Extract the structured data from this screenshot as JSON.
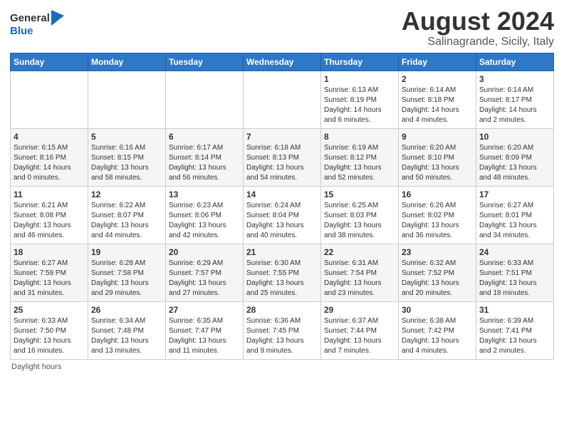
{
  "header": {
    "logo_general": "General",
    "logo_blue": "Blue",
    "month_year": "August 2024",
    "location": "Salinagrande, Sicily, Italy"
  },
  "weekdays": [
    "Sunday",
    "Monday",
    "Tuesday",
    "Wednesday",
    "Thursday",
    "Friday",
    "Saturday"
  ],
  "weeks": [
    [
      {
        "day": "",
        "info": ""
      },
      {
        "day": "",
        "info": ""
      },
      {
        "day": "",
        "info": ""
      },
      {
        "day": "",
        "info": ""
      },
      {
        "day": "1",
        "info": "Sunrise: 6:13 AM\nSunset: 8:19 PM\nDaylight: 14 hours\nand 6 minutes."
      },
      {
        "day": "2",
        "info": "Sunrise: 6:14 AM\nSunset: 8:18 PM\nDaylight: 14 hours\nand 4 minutes."
      },
      {
        "day": "3",
        "info": "Sunrise: 6:14 AM\nSunset: 8:17 PM\nDaylight: 14 hours\nand 2 minutes."
      }
    ],
    [
      {
        "day": "4",
        "info": "Sunrise: 6:15 AM\nSunset: 8:16 PM\nDaylight: 14 hours\nand 0 minutes."
      },
      {
        "day": "5",
        "info": "Sunrise: 6:16 AM\nSunset: 8:15 PM\nDaylight: 13 hours\nand 58 minutes."
      },
      {
        "day": "6",
        "info": "Sunrise: 6:17 AM\nSunset: 8:14 PM\nDaylight: 13 hours\nand 56 minutes."
      },
      {
        "day": "7",
        "info": "Sunrise: 6:18 AM\nSunset: 8:13 PM\nDaylight: 13 hours\nand 54 minutes."
      },
      {
        "day": "8",
        "info": "Sunrise: 6:19 AM\nSunset: 8:12 PM\nDaylight: 13 hours\nand 52 minutes."
      },
      {
        "day": "9",
        "info": "Sunrise: 6:20 AM\nSunset: 8:10 PM\nDaylight: 13 hours\nand 50 minutes."
      },
      {
        "day": "10",
        "info": "Sunrise: 6:20 AM\nSunset: 8:09 PM\nDaylight: 13 hours\nand 48 minutes."
      }
    ],
    [
      {
        "day": "11",
        "info": "Sunrise: 6:21 AM\nSunset: 8:08 PM\nDaylight: 13 hours\nand 46 minutes."
      },
      {
        "day": "12",
        "info": "Sunrise: 6:22 AM\nSunset: 8:07 PM\nDaylight: 13 hours\nand 44 minutes."
      },
      {
        "day": "13",
        "info": "Sunrise: 6:23 AM\nSunset: 8:06 PM\nDaylight: 13 hours\nand 42 minutes."
      },
      {
        "day": "14",
        "info": "Sunrise: 6:24 AM\nSunset: 8:04 PM\nDaylight: 13 hours\nand 40 minutes."
      },
      {
        "day": "15",
        "info": "Sunrise: 6:25 AM\nSunset: 8:03 PM\nDaylight: 13 hours\nand 38 minutes."
      },
      {
        "day": "16",
        "info": "Sunrise: 6:26 AM\nSunset: 8:02 PM\nDaylight: 13 hours\nand 36 minutes."
      },
      {
        "day": "17",
        "info": "Sunrise: 6:27 AM\nSunset: 8:01 PM\nDaylight: 13 hours\nand 34 minutes."
      }
    ],
    [
      {
        "day": "18",
        "info": "Sunrise: 6:27 AM\nSunset: 7:59 PM\nDaylight: 13 hours\nand 31 minutes."
      },
      {
        "day": "19",
        "info": "Sunrise: 6:28 AM\nSunset: 7:58 PM\nDaylight: 13 hours\nand 29 minutes."
      },
      {
        "day": "20",
        "info": "Sunrise: 6:29 AM\nSunset: 7:57 PM\nDaylight: 13 hours\nand 27 minutes."
      },
      {
        "day": "21",
        "info": "Sunrise: 6:30 AM\nSunset: 7:55 PM\nDaylight: 13 hours\nand 25 minutes."
      },
      {
        "day": "22",
        "info": "Sunrise: 6:31 AM\nSunset: 7:54 PM\nDaylight: 13 hours\nand 23 minutes."
      },
      {
        "day": "23",
        "info": "Sunrise: 6:32 AM\nSunset: 7:52 PM\nDaylight: 13 hours\nand 20 minutes."
      },
      {
        "day": "24",
        "info": "Sunrise: 6:33 AM\nSunset: 7:51 PM\nDaylight: 13 hours\nand 18 minutes."
      }
    ],
    [
      {
        "day": "25",
        "info": "Sunrise: 6:33 AM\nSunset: 7:50 PM\nDaylight: 13 hours\nand 16 minutes."
      },
      {
        "day": "26",
        "info": "Sunrise: 6:34 AM\nSunset: 7:48 PM\nDaylight: 13 hours\nand 13 minutes."
      },
      {
        "day": "27",
        "info": "Sunrise: 6:35 AM\nSunset: 7:47 PM\nDaylight: 13 hours\nand 11 minutes."
      },
      {
        "day": "28",
        "info": "Sunrise: 6:36 AM\nSunset: 7:45 PM\nDaylight: 13 hours\nand 9 minutes."
      },
      {
        "day": "29",
        "info": "Sunrise: 6:37 AM\nSunset: 7:44 PM\nDaylight: 13 hours\nand 7 minutes."
      },
      {
        "day": "30",
        "info": "Sunrise: 6:38 AM\nSunset: 7:42 PM\nDaylight: 13 hours\nand 4 minutes."
      },
      {
        "day": "31",
        "info": "Sunrise: 6:39 AM\nSunset: 7:41 PM\nDaylight: 13 hours\nand 2 minutes."
      }
    ]
  ],
  "footer": "Daylight hours"
}
